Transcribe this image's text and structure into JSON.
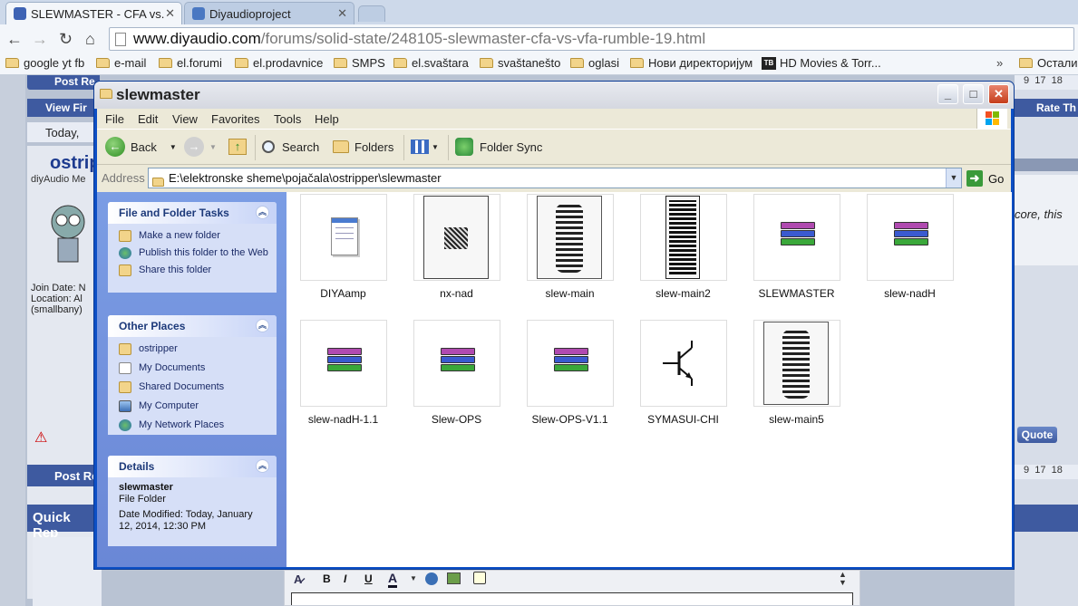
{
  "browser": {
    "tabs": [
      {
        "label": "SLEWMASTER - CFA vs.",
        "active": true
      },
      {
        "label": "Diyaudioproject",
        "active": false
      }
    ],
    "url_host": "www.diyaudio.com",
    "url_path": "/forums/solid-state/248105-slewmaster-cfa-vs-vfa-rumble-19.html",
    "bookmarks": [
      "google yt fb",
      "e-mail",
      "el.forumi",
      "el.prodavnice",
      "SMPS",
      "el.svaštara",
      "svaštanešto",
      "oglasi",
      "Нови директоријум",
      "HD Movies & Torr...",
      "Остали"
    ],
    "bookmarks_overflow": "»"
  },
  "background_page": {
    "post_reply": "Post Re",
    "view_first": "View Fir",
    "today": "Today,",
    "user": "ostrip",
    "user_role": "diyAudio Me",
    "join_date": "Join Date: N",
    "location": "Location: Al",
    "smallbany": "(smallbany)",
    "rate_thread": "Rate Th",
    "right_text": "core, this",
    "quote_label": "Quote",
    "quick_reply": "Quick Rep",
    "pages": [
      "9",
      "17",
      "18"
    ],
    "post_reply2": "Post Re"
  },
  "window": {
    "title": "slewmaster",
    "menu": [
      "File",
      "Edit",
      "View",
      "Favorites",
      "Tools",
      "Help"
    ],
    "toolbar": {
      "back": "Back",
      "search": "Search",
      "folders": "Folders",
      "folder_sync": "Folder Sync"
    },
    "address_label": "Address",
    "address_value": "E:\\elektronske sheme\\pojačala\\ostripper\\slewmaster",
    "go_label": "Go"
  },
  "tasks": {
    "file_folder": {
      "title": "File and Folder Tasks",
      "items": [
        "Make a new folder",
        "Publish this folder to the Web",
        "Share this folder"
      ]
    },
    "other_places": {
      "title": "Other Places",
      "items": [
        "ostripper",
        "My Documents",
        "Shared Documents",
        "My Computer",
        "My Network Places"
      ]
    },
    "details": {
      "title": "Details",
      "name": "slewmaster",
      "type": "File Folder",
      "modified": "Date Modified: Today, January 12, 2014, 12:30 PM"
    }
  },
  "files": [
    {
      "name": "DIYAamp",
      "icon": "notepad-icon"
    },
    {
      "name": "nx-nad",
      "icon": "pcb-thumbnail"
    },
    {
      "name": "slew-main",
      "icon": "pcb-thumbnail"
    },
    {
      "name": "slew-main2",
      "icon": "pcb-thumbnail"
    },
    {
      "name": "SLEWMASTER",
      "icon": "winrar-icon"
    },
    {
      "name": "slew-nadH",
      "icon": "winrar-icon"
    },
    {
      "name": "slew-nadH-1.1",
      "icon": "winrar-icon"
    },
    {
      "name": "Slew-OPS",
      "icon": "winrar-icon"
    },
    {
      "name": "Slew-OPS-V1.1",
      "icon": "winrar-icon"
    },
    {
      "name": "SYMASUI-CHI",
      "icon": "transistor-thumbnail"
    },
    {
      "name": "slew-main5",
      "icon": "pcb-thumbnail"
    }
  ],
  "editor": {
    "bold": "B",
    "italic": "I",
    "underline": "U",
    "font_color": "A"
  }
}
